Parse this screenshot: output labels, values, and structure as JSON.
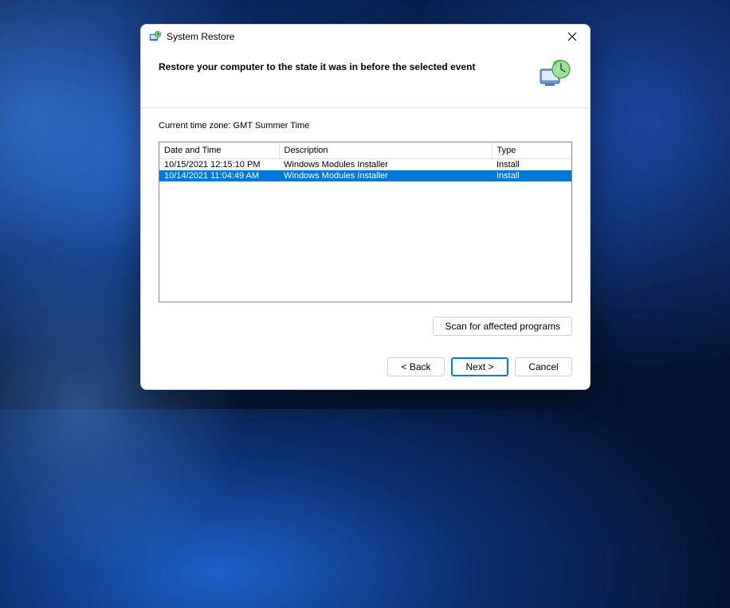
{
  "window": {
    "title": "System Restore"
  },
  "header": {
    "heading": "Restore your computer to the state it was in before the selected event"
  },
  "content": {
    "timezone_label": "Current time zone: GMT Summer Time",
    "columns": {
      "date": "Date and Time",
      "description": "Description",
      "type": "Type"
    },
    "rows": [
      {
        "date": "10/15/2021 12:15:10 PM",
        "description": "Windows Modules Installer",
        "type": "Install",
        "selected": false
      },
      {
        "date": "10/14/2021 11:04:49 AM",
        "description": "Windows Modules Installer",
        "type": "Install",
        "selected": true
      }
    ],
    "scan_button": "Scan for affected programs"
  },
  "footer": {
    "back": "< Back",
    "next": "Next >",
    "cancel": "Cancel"
  }
}
